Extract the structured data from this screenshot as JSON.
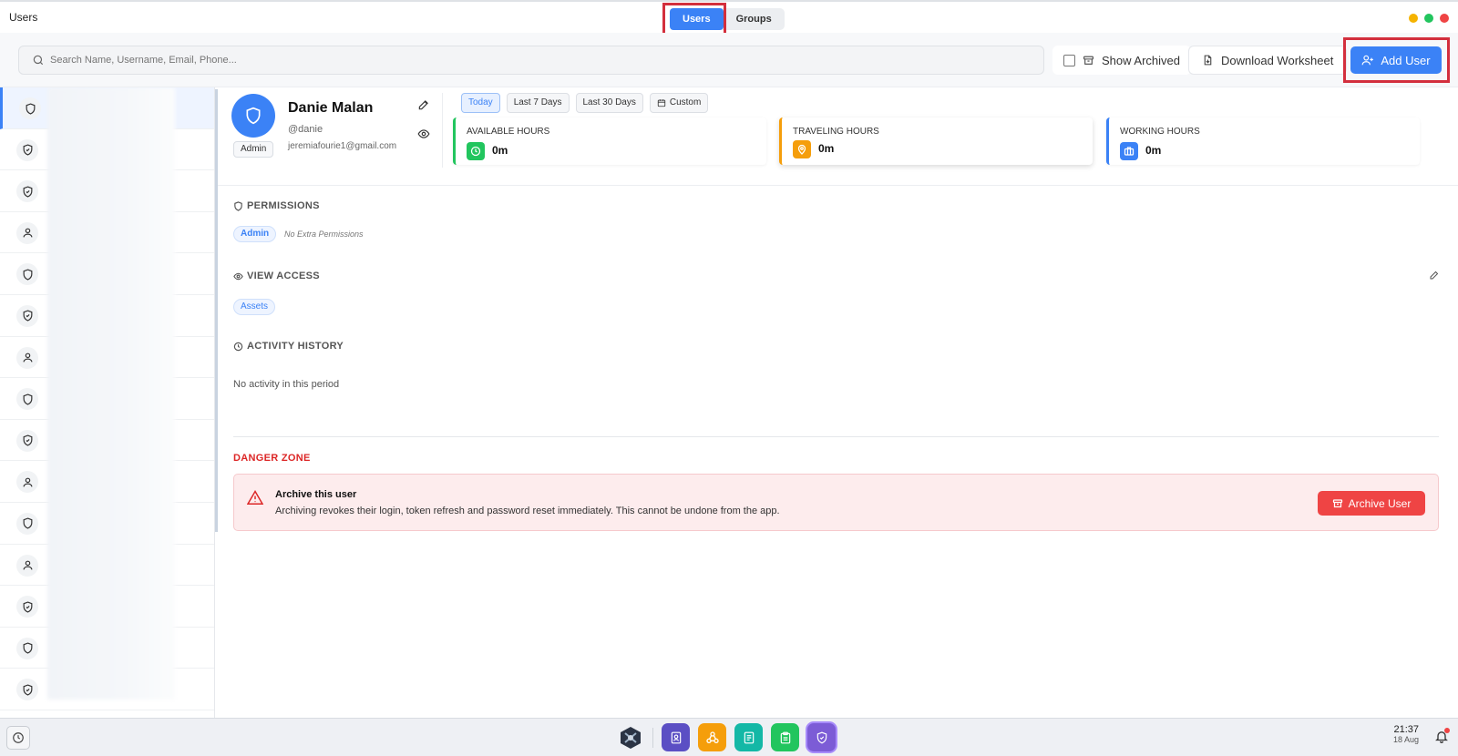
{
  "window": {
    "title": "Users"
  },
  "tabs": [
    {
      "label": "Users",
      "active": true
    },
    {
      "label": "Groups",
      "active": false
    }
  ],
  "traffic_colors": [
    "#f5b301",
    "#22c55e",
    "#ef4444"
  ],
  "toolbar": {
    "search_placeholder": "Search Name, Username, Email, Phone...",
    "show_archived_label": "Show Archived",
    "download_label": "Download Worksheet",
    "add_user_label": "Add User"
  },
  "user_list": {
    "icons": [
      "shield-icon",
      "shield-check-icon",
      "shield-check-icon",
      "user-icon",
      "shield-icon",
      "shield-check-icon",
      "user-icon",
      "shield-icon",
      "shield-check-icon",
      "user-icon",
      "shield-icon",
      "user-icon",
      "shield-check-icon",
      "shield-icon",
      "shield-check-icon"
    ],
    "selected_index": 0
  },
  "user": {
    "name": "Danie Malan",
    "handle": "@danie",
    "email": "jeremiafourie1@gmail.com",
    "role": "Admin"
  },
  "ranges": [
    "Today",
    "Last 7 Days",
    "Last 30 Days",
    "Custom"
  ],
  "active_range": "Today",
  "stats": [
    {
      "label": "AVAILABLE HOURS",
      "value": "0m",
      "color": "#22c55e"
    },
    {
      "label": "TRAVELING HOURS",
      "value": "0m",
      "color": "#f59e0b"
    },
    {
      "label": "WORKING HOURS",
      "value": "0m",
      "color": "#3b82f6"
    }
  ],
  "permissions": {
    "title": "PERMISSIONS",
    "role_chip": "Admin",
    "note": "No Extra Permissions"
  },
  "view_access": {
    "title": "VIEW ACCESS",
    "chip": "Assets"
  },
  "activity": {
    "title": "ACTIVITY HISTORY",
    "empty": "No activity in this period"
  },
  "danger": {
    "title": "DANGER ZONE",
    "heading": "Archive this user",
    "text": "Archiving revokes their login, token refresh and password reset immediately. This cannot be undone from the app.",
    "button": "Archive User"
  },
  "taskbar": {
    "time": "21:37",
    "date": "18 Aug",
    "dock_colors": [
      "#5b4fc4",
      "#f59e0b",
      "#14b8a6",
      "#22c55e",
      "#7c5cd6"
    ]
  }
}
